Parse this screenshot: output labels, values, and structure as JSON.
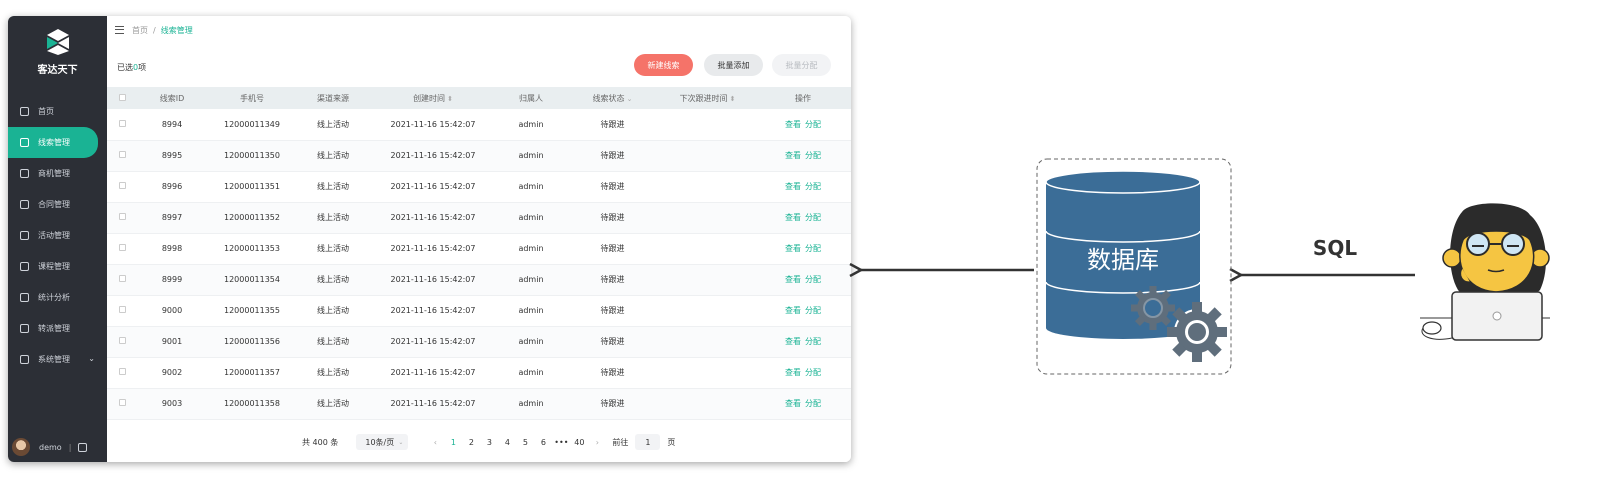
{
  "app": {
    "brand_name": "客达天下",
    "menu": [
      {
        "label": "首页",
        "icon": "home-icon",
        "active": false
      },
      {
        "label": "线索管理",
        "icon": "clue-icon",
        "active": true
      },
      {
        "label": "商机管理",
        "icon": "opportunity-icon",
        "active": false
      },
      {
        "label": "合同管理",
        "icon": "contract-icon",
        "active": false
      },
      {
        "label": "活动管理",
        "icon": "activity-icon",
        "active": false
      },
      {
        "label": "课程管理",
        "icon": "course-icon",
        "active": false
      },
      {
        "label": "统计分析",
        "icon": "chart-icon",
        "active": false
      },
      {
        "label": "转派管理",
        "icon": "transfer-icon",
        "active": false
      },
      {
        "label": "系统管理",
        "icon": "settings-icon",
        "active": false
      }
    ],
    "user": {
      "name": "demo"
    },
    "breadcrumb": {
      "home": "首页",
      "separator": "/",
      "current": "线索管理"
    },
    "toolbar": {
      "selected_prefix": "已选",
      "selected_count": "0",
      "selected_suffix": "项",
      "new_button": "新建线索",
      "batch_add_button": "批量添加",
      "batch_assign_button": "批量分配"
    },
    "table": {
      "headers": [
        "线索ID",
        "手机号",
        "渠道来源",
        "创建时间",
        "归属人",
        "线索状态",
        "下次跟进时间",
        "操作"
      ],
      "rows": [
        {
          "id": "8994",
          "phone": "12000011349",
          "channel": "线上活动",
          "created": "2021-11-16 15:42:07",
          "owner": "admin",
          "status": "待跟进"
        },
        {
          "id": "8995",
          "phone": "12000011350",
          "channel": "线上活动",
          "created": "2021-11-16 15:42:07",
          "owner": "admin",
          "status": "待跟进"
        },
        {
          "id": "8996",
          "phone": "12000011351",
          "channel": "线上活动",
          "created": "2021-11-16 15:42:07",
          "owner": "admin",
          "status": "待跟进"
        },
        {
          "id": "8997",
          "phone": "12000011352",
          "channel": "线上活动",
          "created": "2021-11-16 15:42:07",
          "owner": "admin",
          "status": "待跟进"
        },
        {
          "id": "8998",
          "phone": "12000011353",
          "channel": "线上活动",
          "created": "2021-11-16 15:42:07",
          "owner": "admin",
          "status": "待跟进"
        },
        {
          "id": "8999",
          "phone": "12000011354",
          "channel": "线上活动",
          "created": "2021-11-16 15:42:07",
          "owner": "admin",
          "status": "待跟进"
        },
        {
          "id": "9000",
          "phone": "12000011355",
          "channel": "线上活动",
          "created": "2021-11-16 15:42:07",
          "owner": "admin",
          "status": "待跟进"
        },
        {
          "id": "9001",
          "phone": "12000011356",
          "channel": "线上活动",
          "created": "2021-11-16 15:42:07",
          "owner": "admin",
          "status": "待跟进"
        },
        {
          "id": "9002",
          "phone": "12000011357",
          "channel": "线上活动",
          "created": "2021-11-16 15:42:07",
          "owner": "admin",
          "status": "待跟进"
        },
        {
          "id": "9003",
          "phone": "12000011358",
          "channel": "线上活动",
          "created": "2021-11-16 15:42:07",
          "owner": "admin",
          "status": "待跟进"
        }
      ],
      "actions": {
        "view": "查看",
        "assign": "分配"
      }
    },
    "pagination": {
      "total": "共 400 条",
      "page_size": "10条/页",
      "pages": [
        "1",
        "2",
        "3",
        "4",
        "5",
        "6",
        "•••",
        "40"
      ],
      "prev": "‹",
      "next": "›",
      "goto_label": "前往",
      "goto_value": "1",
      "goto_suffix": "页"
    }
  },
  "diagram": {
    "database_label": "数据库",
    "query_label": "SQL",
    "colors": {
      "db_fill": "#3b6d97",
      "db_stroke": "#ffffff",
      "gear": "#5f6e7c",
      "arrow": "#333333",
      "monkey": "#f5c542"
    }
  }
}
